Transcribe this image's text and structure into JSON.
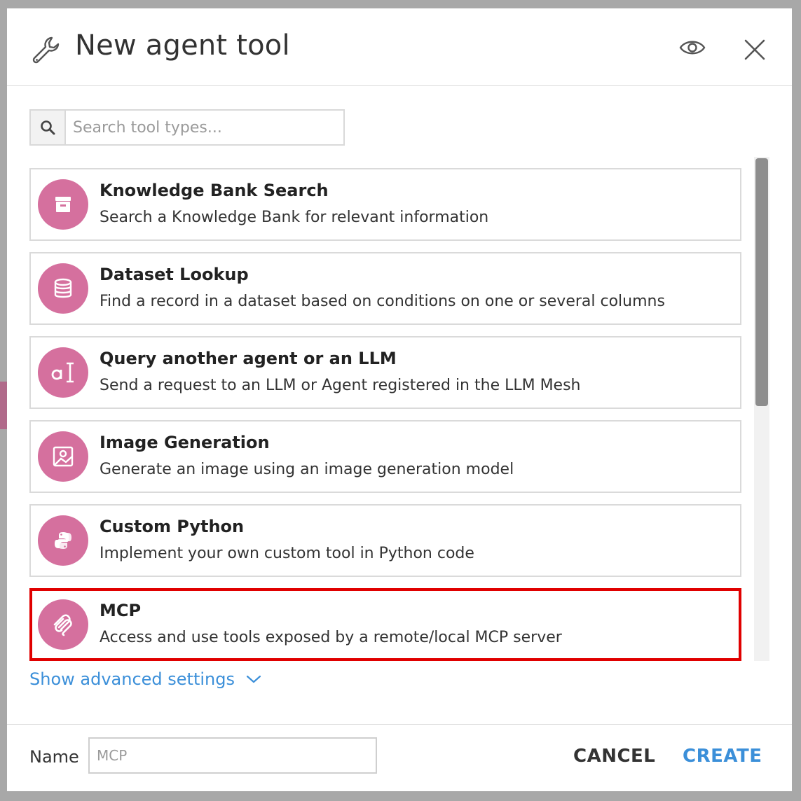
{
  "dialog": {
    "title": "New agent tool",
    "header_icon": "wrench-icon",
    "preview_icon": "eye-icon",
    "close_icon": "close-icon"
  },
  "search": {
    "placeholder": "Search tool types...",
    "value": "",
    "icon": "search-icon"
  },
  "tools": [
    {
      "name": "Knowledge Bank Search",
      "description": "Search a Knowledge Bank for relevant information",
      "icon": "archive-box-icon"
    },
    {
      "name": "Dataset Lookup",
      "description": "Find a record in a dataset based on conditions on one or several columns",
      "icon": "database-icon"
    },
    {
      "name": "Query another agent or an LLM",
      "description": "Send a request to an LLM or Agent registered in the LLM Mesh",
      "icon": "llm-text-icon"
    },
    {
      "name": "Image Generation",
      "description": "Generate an image using an image generation model",
      "icon": "image-icon"
    },
    {
      "name": "Custom Python",
      "description": "Implement your own custom tool in Python code",
      "icon": "python-icon"
    },
    {
      "name": "MCP",
      "description": "Access and use tools exposed by a remote/local MCP server",
      "icon": "mcp-icon",
      "selected": true
    }
  ],
  "advanced": {
    "label": "Show advanced settings",
    "icon": "chevron-down-icon"
  },
  "footer": {
    "name_label": "Name",
    "name_placeholder": "MCP",
    "name_value": "",
    "cancel_label": "CANCEL",
    "create_label": "CREATE"
  },
  "colors": {
    "accent_blue": "#3b8fd9",
    "tool_icon_pink": "#d5709e",
    "selection_red": "#e00000"
  }
}
